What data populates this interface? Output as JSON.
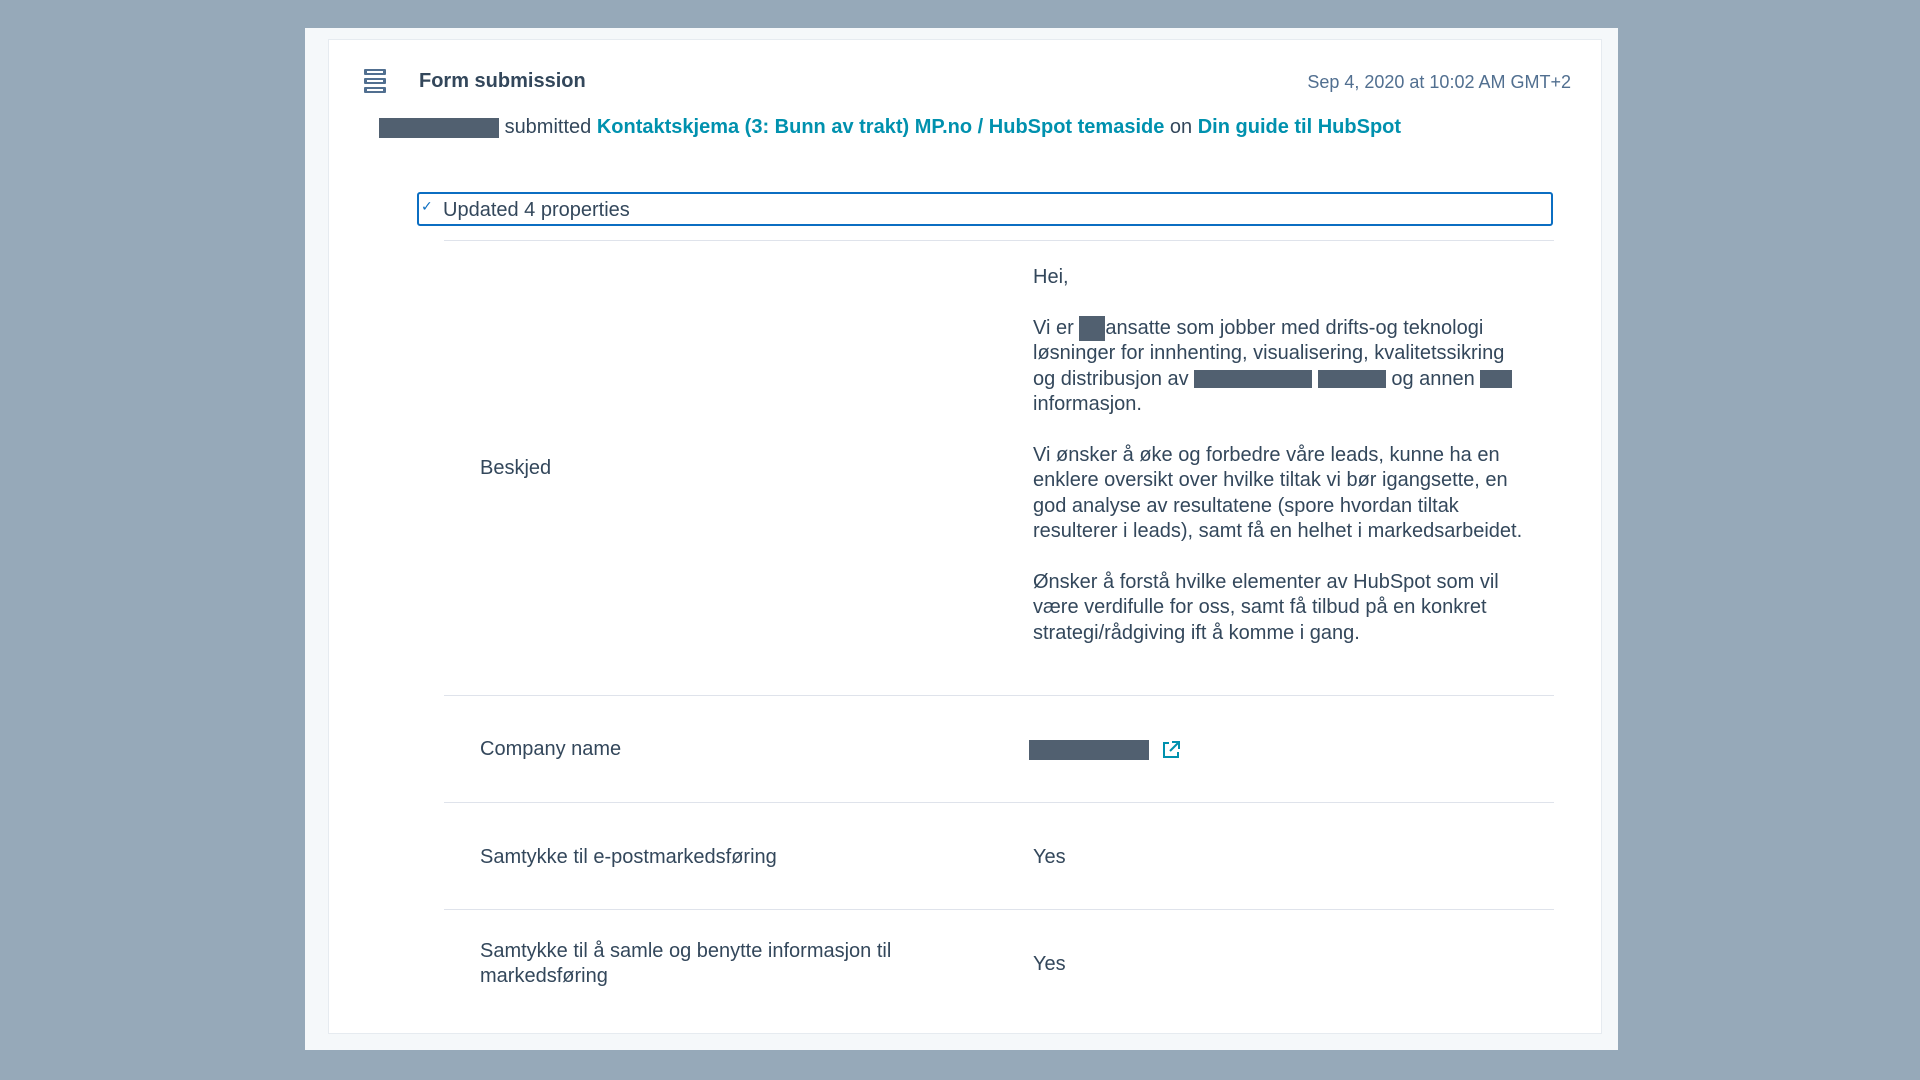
{
  "header": {
    "title": "Form submission",
    "timestamp": "Sep 4, 2020 at 10:02 AM GMT+2",
    "icon": "form-icon"
  },
  "summary": {
    "verb": "submitted",
    "form_link": "Kontaktskjema (3: Bunn av trakt) MP.no /  HubSpot temaside",
    "on_text": "on",
    "page_link": "Din guide til HubSpot"
  },
  "updated": {
    "label": "Updated 4 properties"
  },
  "properties": [
    {
      "label": "Beskjed",
      "message": {
        "p1": "Hei,",
        "p2_a": "Vi er",
        "p2_b": "ansatte som jobber med drifts-og teknologi løsninger for innhenting, visualisering, kvalitetssikring og distribusjon av",
        "p2_c": "og annen",
        "p2_d": "informasjon.",
        "p3": "Vi ønsker å øke og forbedre våre leads, kunne ha en enklere oversikt over hvilke tiltak vi bør igangsette, en god analyse av resultatene (spore hvordan tiltak resulterer i leads), samt få en helhet i markedsarbeidet.",
        "p4": "Ønsker å forstå hvilke elementer av HubSpot som vil være verdifulle for oss, samt få tilbud på en konkret strategi/rådgiving ift å komme i gang."
      }
    },
    {
      "label": "Company name",
      "icon": "external-link-icon"
    },
    {
      "label": "Samtykke til e-postmarkedsføring",
      "value": "Yes"
    },
    {
      "label": "Samtykke til å samle og benytte informasjon til markedsføring",
      "value": "Yes"
    }
  ],
  "colors": {
    "accent_link": "#0091ae",
    "focus_border": "#0b6ec2",
    "redaction": "#516070"
  }
}
